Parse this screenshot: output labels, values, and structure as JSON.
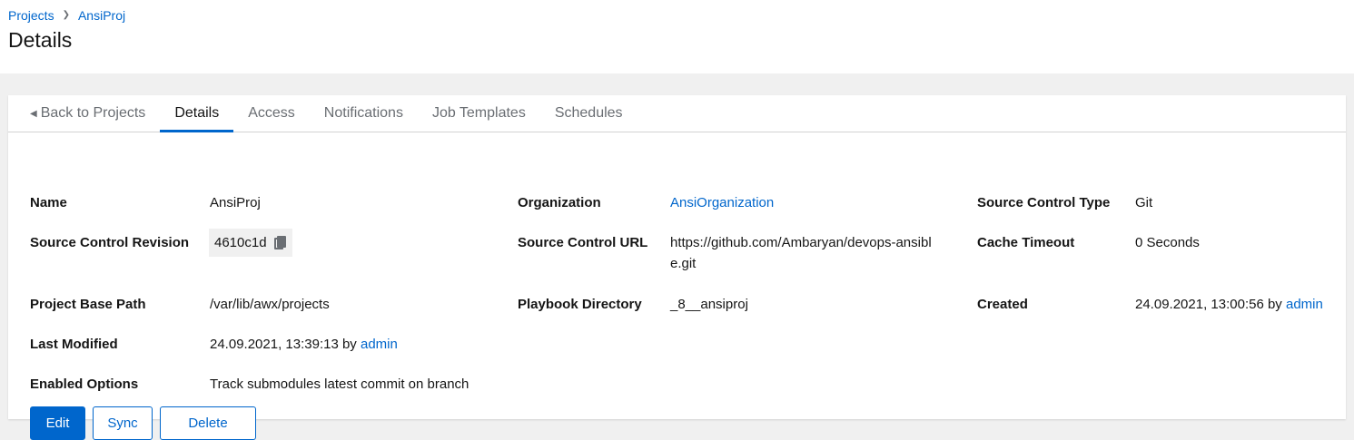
{
  "breadcrumb": {
    "items": [
      "Projects",
      "AnsiProj"
    ]
  },
  "page_title": "Details",
  "tabs": [
    {
      "label": "Back to Projects"
    },
    {
      "label": "Details"
    },
    {
      "label": "Access"
    },
    {
      "label": "Notifications"
    },
    {
      "label": "Job Templates"
    },
    {
      "label": "Schedules"
    }
  ],
  "details": {
    "name": {
      "label": "Name",
      "value": "AnsiProj"
    },
    "organization": {
      "label": "Organization",
      "value": "AnsiOrganization"
    },
    "scm_type": {
      "label": "Source Control Type",
      "value": "Git"
    },
    "scm_revision": {
      "label": "Source Control Revision",
      "value": "4610c1d"
    },
    "scm_url": {
      "label": "Source Control URL",
      "value_line1": "https://github.com/Ambaryan/devops-ansibl",
      "value_line2": "e.git"
    },
    "cache_timeout": {
      "label": "Cache Timeout",
      "value": "0 Seconds"
    },
    "base_path": {
      "label": "Project Base Path",
      "value": "/var/lib/awx/projects"
    },
    "playbook_dir": {
      "label": "Playbook Directory",
      "value": "_8__ansiproj"
    },
    "created": {
      "label": "Created",
      "date": "24.09.2021, 13:00:56",
      "by": "by",
      "user": "admin"
    },
    "last_modified": {
      "label": "Last Modified",
      "date": "24.09.2021, 13:39:13",
      "by": "by",
      "user": "admin"
    },
    "enabled_options": {
      "label": "Enabled Options",
      "value": "Track submodules latest commit on branch"
    }
  },
  "actions": {
    "edit": "Edit",
    "sync": "Sync",
    "delete": "Delete"
  },
  "colors": {
    "link": "#0066cc",
    "primary": "#0066cc",
    "chip_bg": "#f0f0f0"
  }
}
